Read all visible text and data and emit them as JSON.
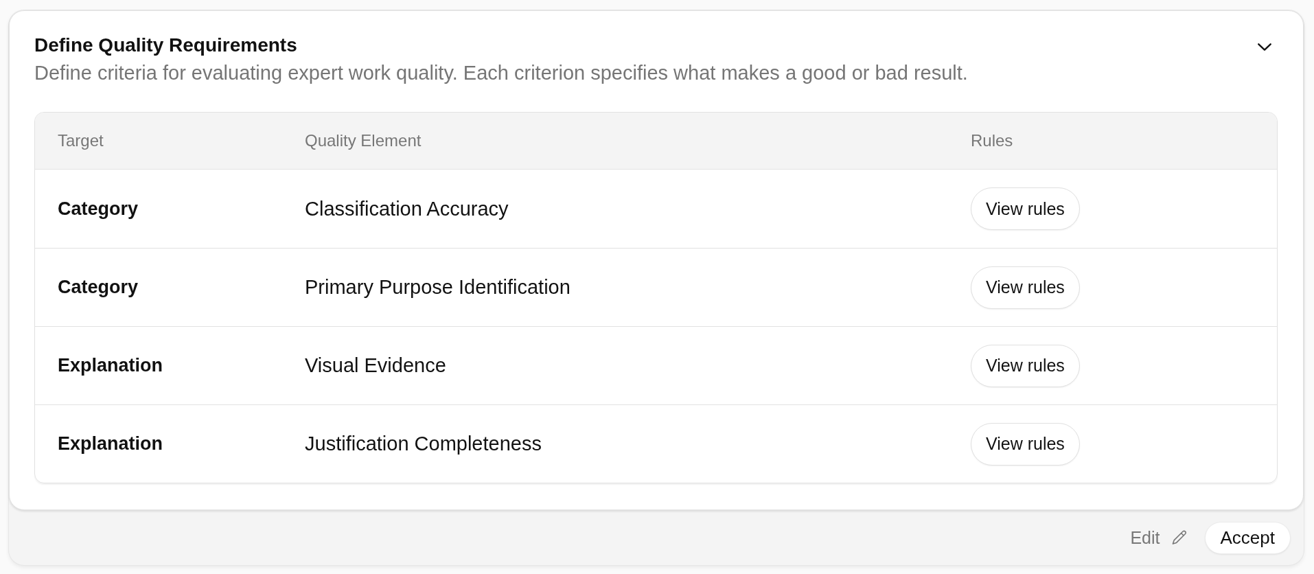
{
  "section": {
    "title": "Define Quality Requirements",
    "description": "Define criteria for evaluating expert work quality. Each criterion specifies what makes a good or bad result.",
    "expanded": true
  },
  "table": {
    "columns": [
      "Target",
      "Quality Element",
      "Rules"
    ],
    "rows": [
      {
        "target": "Category",
        "quality_element": "Classification Accuracy",
        "rules_button": "View rules"
      },
      {
        "target": "Category",
        "quality_element": "Primary Purpose Identification",
        "rules_button": "View rules"
      },
      {
        "target": "Explanation",
        "quality_element": "Visual Evidence",
        "rules_button": "View rules"
      },
      {
        "target": "Explanation",
        "quality_element": "Justification Completeness",
        "rules_button": "View rules"
      }
    ]
  },
  "footer": {
    "edit_button": "Edit",
    "accept_button": "Accept"
  }
}
